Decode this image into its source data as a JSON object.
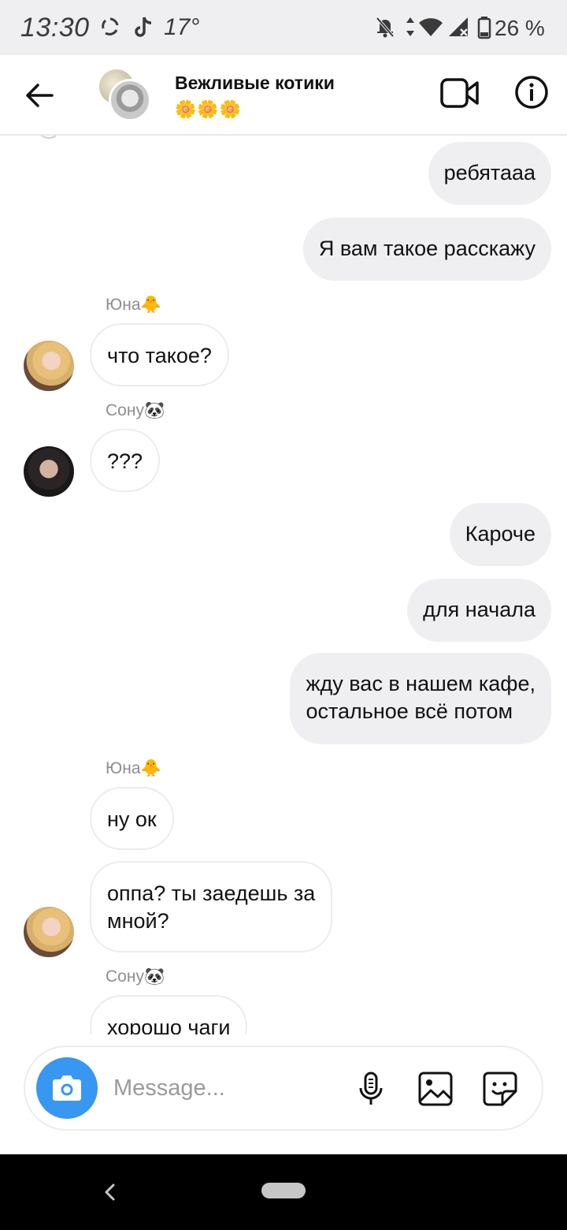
{
  "status_bar": {
    "time": "13:30",
    "temperature": "17°",
    "battery": "26 %",
    "icons": [
      "sync-icon",
      "tiktok-icon",
      "mute-bell-icon",
      "data-arrows-icon",
      "wifi-icon",
      "signal-icon",
      "battery-icon"
    ]
  },
  "header": {
    "title": "Вежливые котики",
    "subtitle": "🌼🌼🌼",
    "icons": [
      "back-arrow-icon",
      "video-call-icon",
      "info-icon"
    ]
  },
  "messages": [
    {
      "id": 1,
      "direction": "out",
      "text": "ребятааа"
    },
    {
      "id": 2,
      "direction": "out",
      "text": "Я вам такое расскажу"
    },
    {
      "id": 3,
      "direction": "in",
      "sender": "Юна🐥",
      "text": "что такое?"
    },
    {
      "id": 4,
      "direction": "in",
      "sender": "Сону🐼",
      "text": "???"
    },
    {
      "id": 5,
      "direction": "out",
      "text": "Кароче"
    },
    {
      "id": 6,
      "direction": "out",
      "text": "для начала"
    },
    {
      "id": 7,
      "direction": "out",
      "lines": [
        "жду вас в нашем кафе,",
        "остальное всё потом"
      ]
    },
    {
      "id": 8,
      "direction": "in",
      "sender": "Юна🐥",
      "text": "ну ок"
    },
    {
      "id": 9,
      "direction": "in",
      "lines": [
        "оппа? ты заедешь за",
        "мной?"
      ]
    },
    {
      "id": 10,
      "direction": "in",
      "sender": "Сону🐼",
      "text": "хорошо чаги"
    }
  ],
  "composer": {
    "placeholder": "Message...",
    "icons": [
      "camera-icon",
      "microphone-icon",
      "gallery-icon",
      "sticker-icon"
    ]
  },
  "colors": {
    "accent": "#3897f0",
    "outgoing_bubble": "#efeff1",
    "incoming_border": "#ececec",
    "status_bar_bg": "#efeff1"
  }
}
